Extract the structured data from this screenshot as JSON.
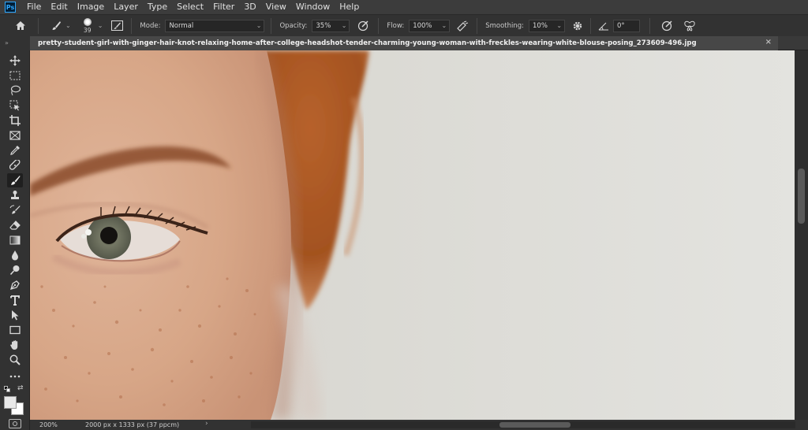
{
  "app": {
    "logo": "Ps"
  },
  "menu": [
    "File",
    "Edit",
    "Image",
    "Layer",
    "Type",
    "Select",
    "Filter",
    "3D",
    "View",
    "Window",
    "Help"
  ],
  "options": {
    "brush_size": "39",
    "mode_label": "Mode:",
    "mode_value": "Normal",
    "opacity_label": "Opacity:",
    "opacity_value": "35%",
    "flow_label": "Flow:",
    "flow_value": "100%",
    "smoothing_label": "Smoothing:",
    "smoothing_value": "10%",
    "angle_value": "0°"
  },
  "tab": {
    "collapse": "»",
    "title": "pretty-student-girl-with-ginger-hair-knot-relaxing-home-after-college-headshot-tender-charming-young-woman-with-freckles-wearing-white-blouse-posing_273609-496.jpg",
    "close": "×"
  },
  "status": {
    "zoom": "200%",
    "doc_info": "2000 px x 1333 px (37 ppcm)",
    "arrow": "›"
  },
  "toolbar_icons": [
    "move-icon",
    "marquee-icon",
    "lasso-icon",
    "object-select-icon",
    "crop-icon",
    "frame-icon",
    "eyedropper-icon",
    "healing-icon",
    "brush-icon",
    "stamp-icon",
    "history-brush-icon",
    "eraser-icon",
    "gradient-icon",
    "blur-icon",
    "dodge-icon",
    "pen-icon",
    "type-icon",
    "path-select-icon",
    "rectangle-icon",
    "hand-icon",
    "zoom-icon",
    "more-icon"
  ],
  "colors": {
    "foreground": "#e8e8e8",
    "background": "#ffffff",
    "accent": "#31a8ff"
  }
}
